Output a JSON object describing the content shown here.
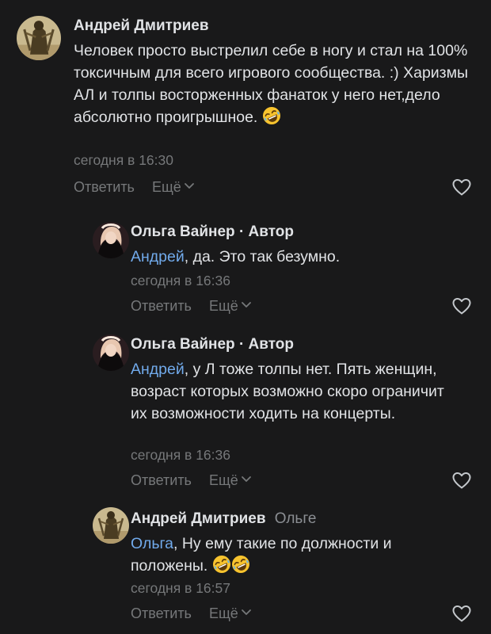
{
  "comments": [
    {
      "author": "Андрей Дмитриев",
      "text": "Человек просто выстрелил себе в ногу и стал на 100% токсичным для всего игрового сообщества. :) Харизмы АЛ и толпы восторженных фанаток у него нет,дело абсолютно проигрышное.",
      "time": "сегодня в 16:30",
      "reply": "Ответить",
      "more": "Ещё"
    },
    {
      "author": "Ольга Вайнер",
      "badge": "· Автор",
      "mention": "Андрей",
      "text": ", да. Это так безумно.",
      "time": "сегодня в 16:36",
      "reply": "Ответить",
      "more": "Ещё"
    },
    {
      "author": "Ольга Вайнер",
      "badge": "· Автор",
      "mention": "Андрей",
      "text": ", у Л тоже толпы нет. Пять женщин, возраст которых возможно скоро ограничит их возможности ходить на концерты.",
      "time": "сегодня в 16:36",
      "reply": "Ответить",
      "more": "Ещё"
    },
    {
      "author": "Андрей Дмитриев",
      "reply_to": "Ольге",
      "mention": "Ольга",
      "text": ", Ну ему такие по должности и положены.",
      "time": "сегодня в 16:57",
      "reply": "Ответить",
      "more": "Ещё"
    }
  ],
  "icons": {
    "emoji": "rolling-on-floor-laughing-emoji",
    "like": "heart-outline-icon",
    "more_chevron": "chevron-down-icon"
  },
  "colors": {
    "background": "#19191a",
    "text": "#e1e3e6",
    "secondary": "#76787a",
    "mention": "#71aaeb"
  }
}
